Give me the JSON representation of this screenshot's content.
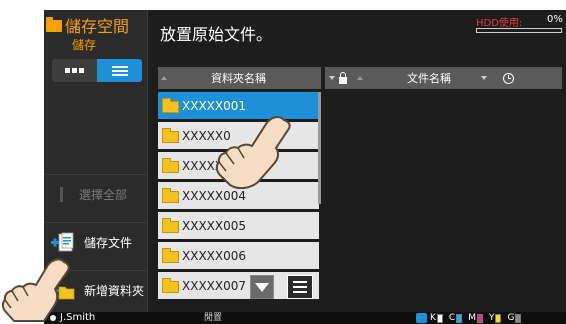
{
  "app": {
    "title": "儲存空間",
    "subtitle": "儲存"
  },
  "header": {
    "page_title": "放置原始文件。",
    "hdd_label": "HDD使用:",
    "hdd_value": "0%",
    "hdd_usage_fraction": 0
  },
  "sidebar": {
    "view_toggle": {
      "grid_icon": "grid-view-icon",
      "list_icon": "list-view-icon",
      "active": "list"
    },
    "select_all_label": "選擇全部",
    "store_document_label": "儲存文件",
    "new_folder_label": "新增資料夾"
  },
  "columns": {
    "folder_name_header": "資料夾名稱",
    "file_name_header": "文件名稱"
  },
  "folders": [
    {
      "name": "XXXXX001",
      "selected": true
    },
    {
      "name": "XXXXX0",
      "selected": false
    },
    {
      "name": "XXXXX",
      "selected": false
    },
    {
      "name": "XXXXX004",
      "selected": false
    },
    {
      "name": "XXXXX005",
      "selected": false
    },
    {
      "name": "XXXXX006",
      "selected": false
    },
    {
      "name": "XXXXX007",
      "selected": false
    }
  ],
  "status_bar": {
    "user": "J.Smith",
    "status": "閒置",
    "toner": [
      {
        "letter": "K",
        "color": "#ffffff"
      },
      {
        "letter": "C",
        "color": "#1ab0e8"
      },
      {
        "letter": "M",
        "color": "#e0308f"
      },
      {
        "letter": "Y",
        "color": "#f5e000"
      },
      {
        "letter": "G",
        "color": "#8a8a8a"
      }
    ]
  },
  "colors": {
    "accent": "#f5a100",
    "selection": "#1e90d8",
    "hdd_label": "#e23c3c"
  }
}
